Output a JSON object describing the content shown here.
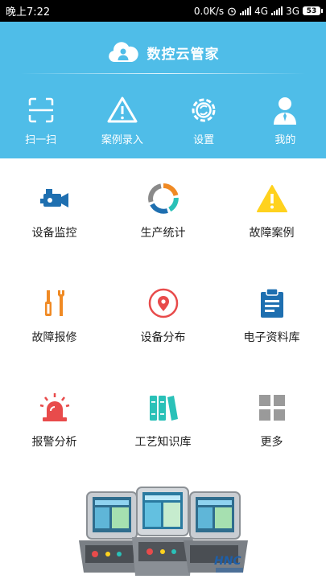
{
  "status": {
    "time": "晚上7:22",
    "net_speed": "0.0K/s",
    "net1": "4G",
    "net2": "3G",
    "battery": "53"
  },
  "brand": {
    "title": "数控云管家"
  },
  "quick": [
    {
      "label": "扫一扫",
      "icon": "scan-icon"
    },
    {
      "label": "案例录入",
      "icon": "warning-icon"
    },
    {
      "label": "设置",
      "icon": "settings-gear-icon"
    },
    {
      "label": "我的",
      "icon": "user-icon"
    }
  ],
  "grid": [
    {
      "label": "设备监控",
      "icon": "video-camera-icon"
    },
    {
      "label": "生产统计",
      "icon": "donut-chart-icon"
    },
    {
      "label": "故障案例",
      "icon": "warning-triangle-icon"
    },
    {
      "label": "故障报修",
      "icon": "repair-tools-icon"
    },
    {
      "label": "设备分布",
      "icon": "location-pin-icon"
    },
    {
      "label": "电子资料库",
      "icon": "clipboard-icon"
    },
    {
      "label": "报警分析",
      "icon": "alarm-siren-icon"
    },
    {
      "label": "工艺知识库",
      "icon": "books-icon"
    },
    {
      "label": "更多",
      "icon": "grid-more-icon"
    }
  ],
  "colors": {
    "header": "#4fbde8",
    "status_bar": "#000000",
    "accent_blue": "#1e6fb0",
    "orange": "#f08a24",
    "red": "#e84b4b",
    "yellow": "#ffd21e",
    "teal": "#2ac1b8",
    "gray": "#9a9a9a"
  }
}
